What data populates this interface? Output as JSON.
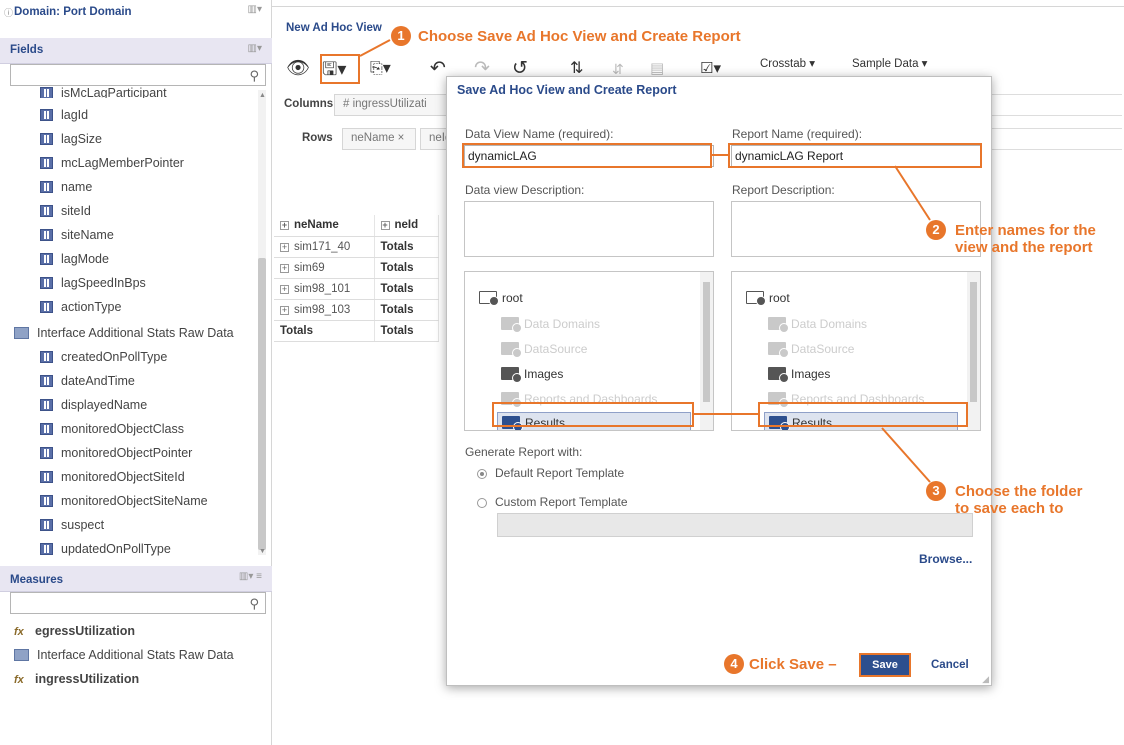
{
  "left": {
    "domain_title": "Domain: Port Domain",
    "fields_title": "Fields",
    "field_items": [
      "isMcLagParticipant",
      "lagId",
      "lagSize",
      "mcLagMemberPointer",
      "name",
      "siteId",
      "siteName",
      "lagMode",
      "lagSpeedInBps",
      "actionType"
    ],
    "group_label": "Interface Additional Stats Raw Data",
    "group_items": [
      "createdOnPollType",
      "dateAndTime",
      "displayedName",
      "monitoredObjectClass",
      "monitoredObjectPointer",
      "monitoredObjectSiteId",
      "monitoredObjectSiteName",
      "suspect",
      "updatedOnPollType"
    ],
    "measures_title": "Measures",
    "measures": [
      "egressUtilization",
      "Interface Additional Stats Raw Data",
      "ingressUtilization"
    ]
  },
  "view": {
    "title": "New Ad Hoc View",
    "crosstab": "Crosstab ▾",
    "sample_data": "Sample Data ▾",
    "columns_label": "Columns",
    "columns_pill": "# ingressUtilizati",
    "rows_label": "Rows",
    "rows_pill_1": "neName ×",
    "rows_pill_2": "neId",
    "grid_headers": [
      "neName",
      "neId"
    ],
    "grid_rows": [
      [
        "sim171_40",
        "Totals"
      ],
      [
        "sim69",
        "Totals"
      ],
      [
        "sim98_101",
        "Totals"
      ],
      [
        "sim98_103",
        "Totals"
      ],
      [
        "Totals",
        "Totals"
      ]
    ]
  },
  "dialog": {
    "title": "Save Ad Hoc View and Create Report",
    "data_view_name_label": "Data View Name (required):",
    "data_view_name": "dynamicLAG",
    "report_name_label": "Report Name (required):",
    "report_name": "dynamicLAG Report",
    "data_view_desc_label": "Data view Description:",
    "report_desc_label": "Report Description:",
    "folders": [
      "root",
      "Data Domains",
      "DataSource",
      "Images",
      "Reports and Dashboards",
      "Results"
    ],
    "generate_label": "Generate Report with:",
    "default_template": "Default Report Template",
    "custom_template": "Custom Report Template",
    "browse": "Browse...",
    "save": "Save",
    "cancel": "Cancel"
  },
  "annotations": {
    "step1": "Choose Save Ad Hoc View and Create Report",
    "step2_line1": "Enter names for the",
    "step2_line2": "view and the report",
    "step3_line1": "Choose the folder",
    "step3_line2": "to save each to",
    "step4": "Click Save –",
    "n1": "1",
    "n2": "2",
    "n3": "3",
    "n4": "4",
    "accent_color": "#e8762b"
  }
}
